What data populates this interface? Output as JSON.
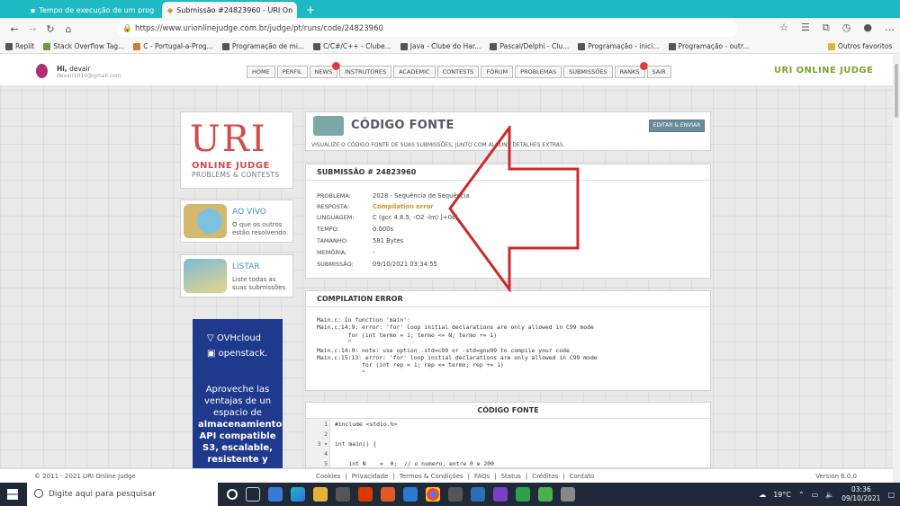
{
  "browser": {
    "tabs": [
      {
        "label": "Tempo de execução de um prog",
        "active": false
      },
      {
        "label": "Submissão #24823960 - URI On",
        "active": true
      }
    ],
    "new_tab": "+",
    "url": "https://www.urionlinejudge.com.br/judge/pt/runs/code/24823960",
    "bookmarks": [
      "Replit",
      "Stack Overflow Tag...",
      "C - Portugal-a-Prog...",
      "Programação de mi...",
      "C/C#/C++ - Clube...",
      "Java - Clube do Har...",
      "Pascal/Delphi - Clu...",
      "Programação - inici...",
      "Programação - outr..."
    ],
    "other_favorites": "Outros favoritos"
  },
  "header": {
    "greeting": "Hi,",
    "user": "devair",
    "email": "devair1010@gmail.com",
    "menu": [
      "HOME",
      "PERFIL",
      "NEWS",
      "INSTRUTORES",
      "ACADEMIC",
      "CONTESTS",
      "FÓRUM",
      "PROBLEMAS",
      "SUBMISSÕES",
      "RANKS",
      "SAIR"
    ],
    "brand": "URI ONLINE JUDGE"
  },
  "sidebar": {
    "logo_big": "URI",
    "logo_line1": "ONLINE JUDGE",
    "logo_line2": "PROBLEMS & CONTESTS",
    "live_title": "AO VIVO",
    "live_desc": "O que os outros estão resolvendo.",
    "list_title": "LISTAR",
    "list_desc": "Liste todas as suas submissões.",
    "ad_brand": "OVHcloud",
    "ad_brand2": "openstack.",
    "ad_text_a": "Aproveche las ventajas de un espacio de",
    "ad_text_b": "almacenamiento API compatible S3,",
    "ad_text_c": "escalable, resistente y"
  },
  "page": {
    "title": "CÓDIGO FONTE",
    "subtitle": "VISUALIZE O CÓDIGO FONTE DE SUAS SUBMISSÕES, JUNTO COM ALGUNS DETALHES EXTRAS.",
    "edit_button": "EDITAR & ENVIAR"
  },
  "submission": {
    "heading": "SUBMISSÃO # 24823960",
    "rows": [
      {
        "key": "PROBLEMA:",
        "value": "2028 - Sequência de Sequência"
      },
      {
        "key": "RESPOSTA:",
        "value": "Compilation error"
      },
      {
        "key": "LINGUAGEM:",
        "value": "C (gcc 4.8.5, -O2 -lm) [+0s]"
      },
      {
        "key": "TEMPO:",
        "value": "0.000s"
      },
      {
        "key": "TAMANHO:",
        "value": "581 Bytes"
      },
      {
        "key": "MEMÓRIA:",
        "value": "-"
      },
      {
        "key": "SUBMISSÃO:",
        "value": "09/10/2021 03:34:55"
      }
    ]
  },
  "compile": {
    "heading": "COMPILATION ERROR",
    "text": "Main.c: In function 'main':\nMain.c:14:9: error: 'for' loop initial declarations are only allowed in C99 mode\n         for (int termo = 1; termo <= N; termo += 1)\n         ^\nMain.c:14:9: note: use option -std=c99 or -std=gnu99 to compile your code\nMain.c:15:13: error: 'for' loop initial declarations are only allowed in C99 mode\n             for (int rep = 1; rep <= termo; rep += 1)\n             ^"
  },
  "code": {
    "heading": "CÓDIGO FONTE",
    "lines": [
      {
        "n": "1",
        "text": "#include <stdio.h>"
      },
      {
        "n": "2",
        "text": ""
      },
      {
        "n": "3 ▾",
        "text": "int main() {"
      },
      {
        "n": "4",
        "text": ""
      },
      {
        "n": "5",
        "text": "    int N    =  0;  // o numero, entre 0 e 200"
      }
    ]
  },
  "footer": {
    "copyright": "© 2011 - 2021 URI Online Judge",
    "links": [
      "Cookies",
      "|",
      "Privacidade",
      "|",
      "Termos & Condições",
      "|",
      "FAQs",
      "|",
      "Status",
      "|",
      "Créditos",
      "|",
      "Contato"
    ],
    "version": "Version 6.0.0"
  },
  "taskbar": {
    "search_placeholder": "Digite aqui para pesquisar",
    "weather": "19°C",
    "time": "03:36",
    "date": "09/10/2021"
  },
  "colors": {
    "accent": "#1ebac3",
    "error": "#d4931f",
    "brand": "#7da52c",
    "uri_red": "#d24a4a"
  }
}
